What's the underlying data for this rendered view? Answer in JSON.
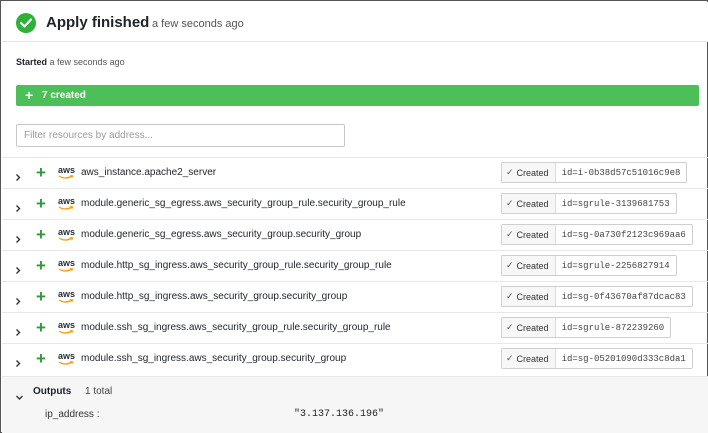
{
  "header": {
    "title": "Apply finished",
    "time": "a few seconds ago"
  },
  "started": {
    "label": "Started",
    "time": "a few seconds ago"
  },
  "summary": {
    "label": "7 created",
    "icon": "plus-icon",
    "color": "#4dbf58"
  },
  "filter": {
    "placeholder": "Filter resources by address..."
  },
  "resources": [
    {
      "provider": "aws",
      "address": "aws_instance.apache2_server",
      "status": "Created",
      "id": "id=i-0b38d57c51016c9e8"
    },
    {
      "provider": "aws",
      "address": "module.generic_sg_egress.aws_security_group_rule.security_group_rule",
      "status": "Created",
      "id": "id=sgrule-3139681753"
    },
    {
      "provider": "aws",
      "address": "module.generic_sg_egress.aws_security_group.security_group",
      "status": "Created",
      "id": "id=sg-0a730f2123c969aa6"
    },
    {
      "provider": "aws",
      "address": "module.http_sg_ingress.aws_security_group_rule.security_group_rule",
      "status": "Created",
      "id": "id=sgrule-2256827914"
    },
    {
      "provider": "aws",
      "address": "module.http_sg_ingress.aws_security_group.security_group",
      "status": "Created",
      "id": "id=sg-0f43670af87dcac83"
    },
    {
      "provider": "aws",
      "address": "module.ssh_sg_ingress.aws_security_group_rule.security_group_rule",
      "status": "Created",
      "id": "id=sgrule-872239260"
    },
    {
      "provider": "aws",
      "address": "module.ssh_sg_ingress.aws_security_group.security_group",
      "status": "Created",
      "id": "id=sg-05201090d333c8da1"
    }
  ],
  "outputs": {
    "title": "Outputs",
    "count": "1 total",
    "items": [
      {
        "key": "ip_address :",
        "value": "\"3.137.136.196\""
      }
    ]
  },
  "colors": {
    "success": "#2eb039",
    "plus": "#2e9b36"
  }
}
